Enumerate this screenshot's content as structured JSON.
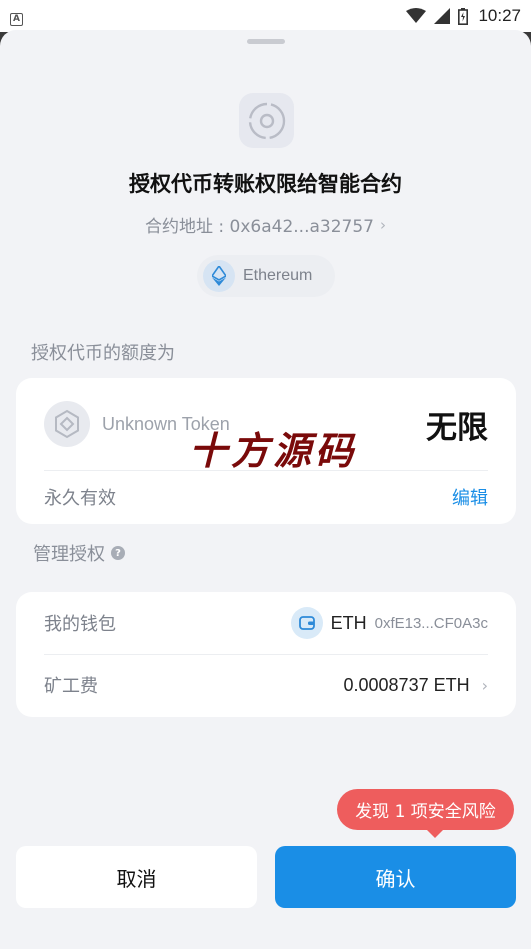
{
  "status_bar": {
    "left_icon": "A",
    "time": "10:27"
  },
  "header": {
    "title": "授权代币转账权限给智能合约",
    "contract_address": "合约地址 : 0x6a42...a32757",
    "chain": "Ethereum"
  },
  "allowance": {
    "section_label": "授权代币的额度为",
    "token_name": "Unknown Token",
    "amount": "无限",
    "validity": "永久有效",
    "edit_label": "编辑"
  },
  "watermark": "十方源码",
  "manage": {
    "section_label": "管理授权",
    "help_icon": "?",
    "wallet_label": "我的钱包",
    "wallet_symbol": "ETH",
    "wallet_address": "0xfE13...CF0A3c",
    "fee_label": "矿工费",
    "fee_value": "0.0008737 ETH"
  },
  "risk_notice": "发现 1 项安全风险",
  "actions": {
    "cancel": "取消",
    "confirm": "确认"
  },
  "colors": {
    "accent": "#1a8ee6",
    "danger": "#ee5d5d",
    "background": "#f2f3f6"
  }
}
